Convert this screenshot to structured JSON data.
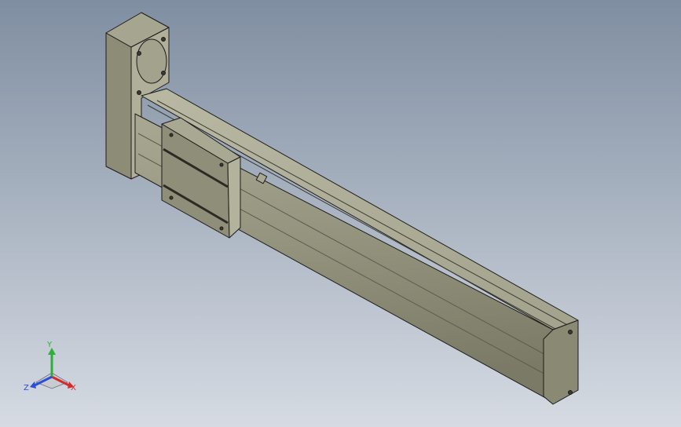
{
  "viewport": {
    "background_top": "#7f8ea1",
    "background_bottom": "#d6dbe3",
    "model_color": "#9b9a84",
    "model_dark": "#6f6e5c",
    "model_light": "#b7b6a0",
    "edge_color": "#1c1c1a"
  },
  "triad": {
    "x_label": "X",
    "y_label": "Y",
    "z_label": "Z",
    "x_color": "#d62a2a",
    "y_color": "#2fae3a",
    "z_color": "#2a4fd6"
  }
}
